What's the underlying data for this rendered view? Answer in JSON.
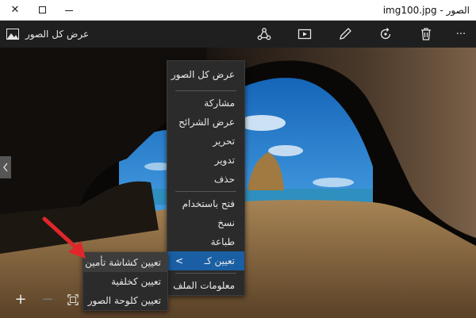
{
  "window": {
    "title": "الصور - img100.jpg",
    "close_glyph": "✕"
  },
  "toolbar": {
    "view_all_label": "عرض كل الصور",
    "icons": [
      "share-icon",
      "slideshow-icon",
      "edit-icon",
      "rotate-icon",
      "delete-icon",
      "more-icon"
    ],
    "more_glyph": "···"
  },
  "menu": {
    "items": [
      {
        "label": "عرض كل الصور"
      },
      {
        "label": "مشاركة"
      },
      {
        "label": "عرض الشرائح"
      },
      {
        "label": "تحرير"
      },
      {
        "label": "تدوير"
      },
      {
        "label": "حذف"
      },
      {
        "label": "فتح باستخدام"
      },
      {
        "label": "نسخ"
      },
      {
        "label": "طباعة"
      },
      {
        "label": "تعيين كـ",
        "submenu_glyph": "<"
      },
      {
        "label": "معلومات الملف"
      }
    ]
  },
  "submenu": {
    "items": [
      {
        "label": "تعيين كشاشة تأمين"
      },
      {
        "label": "تعيين كخلفية"
      },
      {
        "label": "تعيين كلوحة الصور"
      }
    ]
  },
  "bottom": {
    "zoom_in_glyph": "+",
    "zoom_out_glyph": "−"
  },
  "colors": {
    "menu_bg": "#2b2b2b",
    "menu_highlight": "#1a5fa3",
    "toolbar_bg": "#1f1f1f",
    "arrow": "#e0262b"
  }
}
